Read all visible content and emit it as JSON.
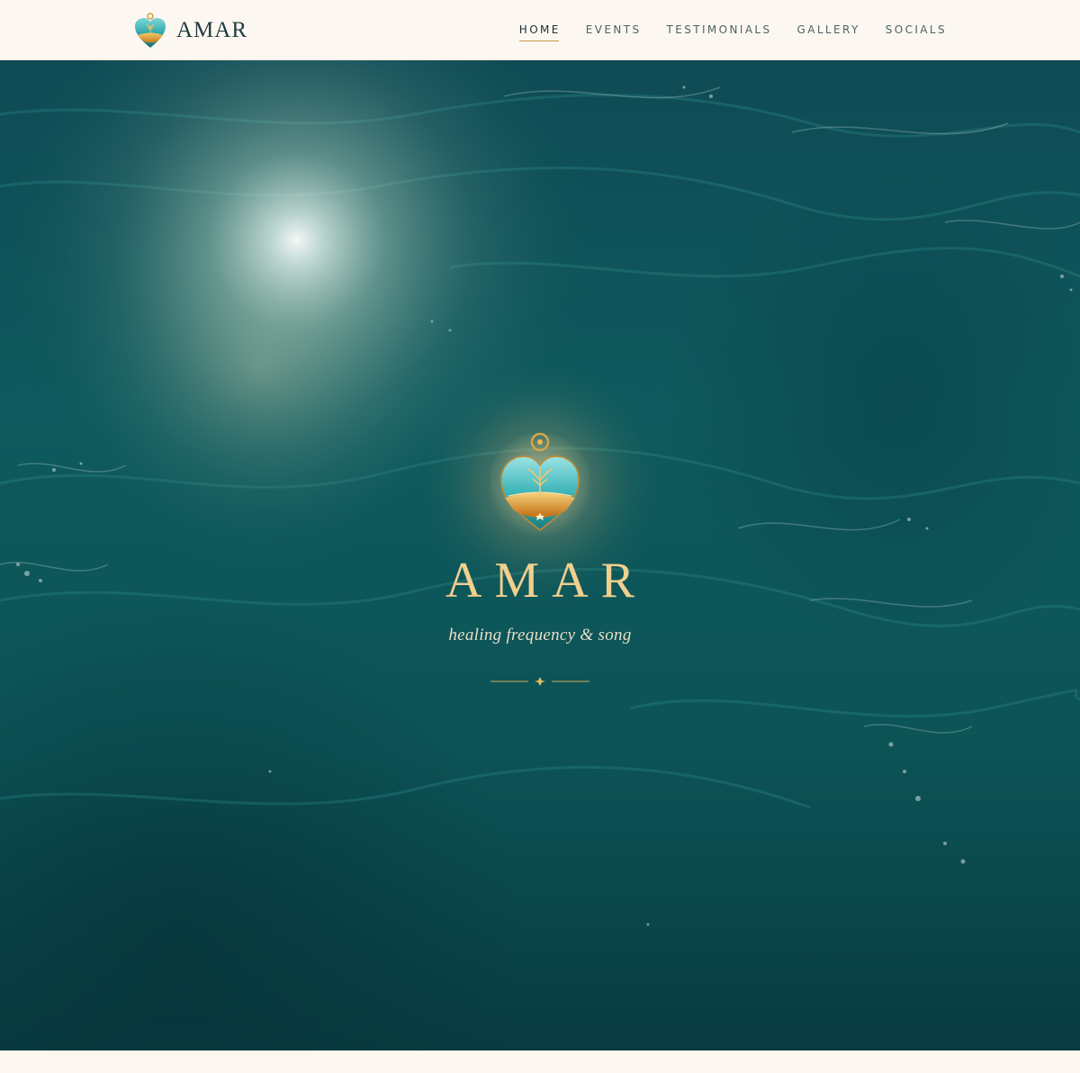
{
  "header": {
    "brand_name": "AMAR",
    "logo_icon": "heart-tree-logo-icon",
    "nav": [
      {
        "label": "HOME",
        "active": true
      },
      {
        "label": "EVENTS",
        "active": false
      },
      {
        "label": "TESTIMONIALS",
        "active": false
      },
      {
        "label": "GALLERY",
        "active": false
      },
      {
        "label": "SOCIALS",
        "active": false
      }
    ]
  },
  "hero": {
    "title": "AMAR",
    "tagline": "healing frequency & song",
    "emblem_icon": "heart-locket-tree-icon",
    "divider_icon": "sparkle-divider-icon",
    "background": "ocean-waves-with-sun-glare"
  },
  "colors": {
    "cream": "#fcf8f1",
    "ocean": "#0f5557",
    "gold": "#f1cf8c",
    "accent": "#c99a44",
    "ink": "#1f3a3f"
  }
}
